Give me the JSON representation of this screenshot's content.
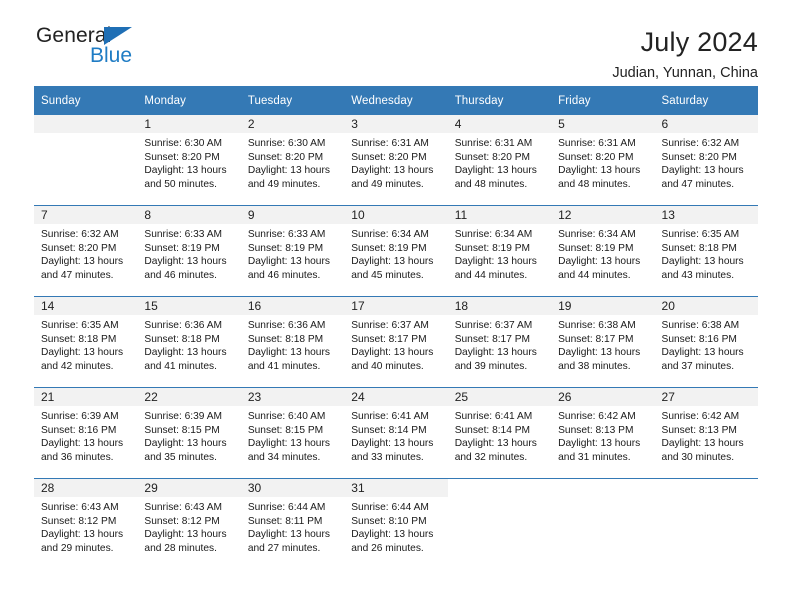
{
  "brand": {
    "name_part1": "General",
    "name_part2": "Blue",
    "triangle_color": "#1f6fb5",
    "blue_text_color": "#1f7cc4"
  },
  "header": {
    "title": "July 2024",
    "subtitle": "Judian, Yunnan, China"
  },
  "theme": {
    "header_bg": "#3479b5",
    "daynum_bg": "#f2f2f2",
    "text": "#1a1a1a"
  },
  "calendar": {
    "weekday_headers": [
      "Sunday",
      "Monday",
      "Tuesday",
      "Wednesday",
      "Thursday",
      "Friday",
      "Saturday"
    ],
    "weeks": [
      [
        {
          "day": "",
          "lines": []
        },
        {
          "day": "1",
          "lines": [
            "Sunrise: 6:30 AM",
            "Sunset: 8:20 PM",
            "Daylight: 13 hours",
            "and 50 minutes."
          ]
        },
        {
          "day": "2",
          "lines": [
            "Sunrise: 6:30 AM",
            "Sunset: 8:20 PM",
            "Daylight: 13 hours",
            "and 49 minutes."
          ]
        },
        {
          "day": "3",
          "lines": [
            "Sunrise: 6:31 AM",
            "Sunset: 8:20 PM",
            "Daylight: 13 hours",
            "and 49 minutes."
          ]
        },
        {
          "day": "4",
          "lines": [
            "Sunrise: 6:31 AM",
            "Sunset: 8:20 PM",
            "Daylight: 13 hours",
            "and 48 minutes."
          ]
        },
        {
          "day": "5",
          "lines": [
            "Sunrise: 6:31 AM",
            "Sunset: 8:20 PM",
            "Daylight: 13 hours",
            "and 48 minutes."
          ]
        },
        {
          "day": "6",
          "lines": [
            "Sunrise: 6:32 AM",
            "Sunset: 8:20 PM",
            "Daylight: 13 hours",
            "and 47 minutes."
          ]
        }
      ],
      [
        {
          "day": "7",
          "lines": [
            "Sunrise: 6:32 AM",
            "Sunset: 8:20 PM",
            "Daylight: 13 hours",
            "and 47 minutes."
          ]
        },
        {
          "day": "8",
          "lines": [
            "Sunrise: 6:33 AM",
            "Sunset: 8:19 PM",
            "Daylight: 13 hours",
            "and 46 minutes."
          ]
        },
        {
          "day": "9",
          "lines": [
            "Sunrise: 6:33 AM",
            "Sunset: 8:19 PM",
            "Daylight: 13 hours",
            "and 46 minutes."
          ]
        },
        {
          "day": "10",
          "lines": [
            "Sunrise: 6:34 AM",
            "Sunset: 8:19 PM",
            "Daylight: 13 hours",
            "and 45 minutes."
          ]
        },
        {
          "day": "11",
          "lines": [
            "Sunrise: 6:34 AM",
            "Sunset: 8:19 PM",
            "Daylight: 13 hours",
            "and 44 minutes."
          ]
        },
        {
          "day": "12",
          "lines": [
            "Sunrise: 6:34 AM",
            "Sunset: 8:19 PM",
            "Daylight: 13 hours",
            "and 44 minutes."
          ]
        },
        {
          "day": "13",
          "lines": [
            "Sunrise: 6:35 AM",
            "Sunset: 8:18 PM",
            "Daylight: 13 hours",
            "and 43 minutes."
          ]
        }
      ],
      [
        {
          "day": "14",
          "lines": [
            "Sunrise: 6:35 AM",
            "Sunset: 8:18 PM",
            "Daylight: 13 hours",
            "and 42 minutes."
          ]
        },
        {
          "day": "15",
          "lines": [
            "Sunrise: 6:36 AM",
            "Sunset: 8:18 PM",
            "Daylight: 13 hours",
            "and 41 minutes."
          ]
        },
        {
          "day": "16",
          "lines": [
            "Sunrise: 6:36 AM",
            "Sunset: 8:18 PM",
            "Daylight: 13 hours",
            "and 41 minutes."
          ]
        },
        {
          "day": "17",
          "lines": [
            "Sunrise: 6:37 AM",
            "Sunset: 8:17 PM",
            "Daylight: 13 hours",
            "and 40 minutes."
          ]
        },
        {
          "day": "18",
          "lines": [
            "Sunrise: 6:37 AM",
            "Sunset: 8:17 PM",
            "Daylight: 13 hours",
            "and 39 minutes."
          ]
        },
        {
          "day": "19",
          "lines": [
            "Sunrise: 6:38 AM",
            "Sunset: 8:17 PM",
            "Daylight: 13 hours",
            "and 38 minutes."
          ]
        },
        {
          "day": "20",
          "lines": [
            "Sunrise: 6:38 AM",
            "Sunset: 8:16 PM",
            "Daylight: 13 hours",
            "and 37 minutes."
          ]
        }
      ],
      [
        {
          "day": "21",
          "lines": [
            "Sunrise: 6:39 AM",
            "Sunset: 8:16 PM",
            "Daylight: 13 hours",
            "and 36 minutes."
          ]
        },
        {
          "day": "22",
          "lines": [
            "Sunrise: 6:39 AM",
            "Sunset: 8:15 PM",
            "Daylight: 13 hours",
            "and 35 minutes."
          ]
        },
        {
          "day": "23",
          "lines": [
            "Sunrise: 6:40 AM",
            "Sunset: 8:15 PM",
            "Daylight: 13 hours",
            "and 34 minutes."
          ]
        },
        {
          "day": "24",
          "lines": [
            "Sunrise: 6:41 AM",
            "Sunset: 8:14 PM",
            "Daylight: 13 hours",
            "and 33 minutes."
          ]
        },
        {
          "day": "25",
          "lines": [
            "Sunrise: 6:41 AM",
            "Sunset: 8:14 PM",
            "Daylight: 13 hours",
            "and 32 minutes."
          ]
        },
        {
          "day": "26",
          "lines": [
            "Sunrise: 6:42 AM",
            "Sunset: 8:13 PM",
            "Daylight: 13 hours",
            "and 31 minutes."
          ]
        },
        {
          "day": "27",
          "lines": [
            "Sunrise: 6:42 AM",
            "Sunset: 8:13 PM",
            "Daylight: 13 hours",
            "and 30 minutes."
          ]
        }
      ],
      [
        {
          "day": "28",
          "lines": [
            "Sunrise: 6:43 AM",
            "Sunset: 8:12 PM",
            "Daylight: 13 hours",
            "and 29 minutes."
          ]
        },
        {
          "day": "29",
          "lines": [
            "Sunrise: 6:43 AM",
            "Sunset: 8:12 PM",
            "Daylight: 13 hours",
            "and 28 minutes."
          ]
        },
        {
          "day": "30",
          "lines": [
            "Sunrise: 6:44 AM",
            "Sunset: 8:11 PM",
            "Daylight: 13 hours",
            "and 27 minutes."
          ]
        },
        {
          "day": "31",
          "lines": [
            "Sunrise: 6:44 AM",
            "Sunset: 8:10 PM",
            "Daylight: 13 hours",
            "and 26 minutes."
          ]
        },
        {
          "day": "",
          "lines": []
        },
        {
          "day": "",
          "lines": []
        },
        {
          "day": "",
          "lines": []
        }
      ]
    ]
  }
}
